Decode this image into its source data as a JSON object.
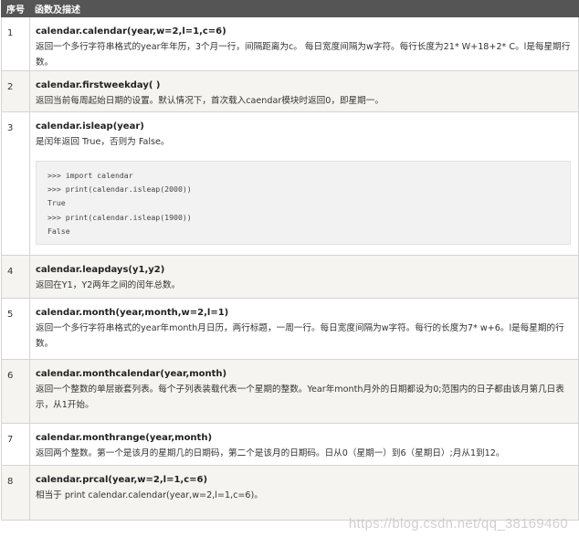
{
  "header": {
    "col_num": "序号",
    "col_desc": "函数及描述"
  },
  "rows": [
    {
      "num": "1",
      "name": "calendar.calendar(year,w=2,l=1,c=6)",
      "desc": "返回一个多行字符串格式的year年年历，3个月一行，间隔距离为c。 每日宽度间隔为w字符。每行长度为21* W+18+2* C。l是每星期行数。"
    },
    {
      "num": "2",
      "name": "calendar.firstweekday( )",
      "desc": "返回当前每周起始日期的设置。默认情况下，首次载入caendar模块时返回0，即星期一。"
    },
    {
      "num": "3",
      "name": "calendar.isleap(year)",
      "desc": "是闰年返回 True，否则为 False。",
      "code": [
        ">>> import calendar",
        ">>> print(calendar.isleap(2000))",
        "True",
        ">>> print(calendar.isleap(1900))",
        "False"
      ]
    },
    {
      "num": "4",
      "name": "calendar.leapdays(y1,y2)",
      "desc": "返回在Y1，Y2两年之间的闰年总数。"
    },
    {
      "num": "5",
      "name": "calendar.month(year,month,w=2,l=1)",
      "desc": "返回一个多行字符串格式的year年month月日历，两行标题，一周一行。每日宽度间隔为w字符。每行的长度为7* w+6。l是每星期的行数。"
    },
    {
      "num": "6",
      "name": "calendar.monthcalendar(year,month)",
      "desc": "返回一个整数的单层嵌套列表。每个子列表装载代表一个星期的整数。Year年month月外的日期都设为0;范围内的日子都由该月第几日表示，从1开始。"
    },
    {
      "num": "7",
      "name": "calendar.monthrange(year,month)",
      "desc": "返回两个整数。第一个是该月的星期几的日期码，第二个是该月的日期码。日从0（星期一）到6（星期日）;月从1到12。"
    },
    {
      "num": "8",
      "name": "calendar.prcal(year,w=2,l=1,c=6)",
      "desc": "相当于 print calendar.calendar(year,w=2,l=1,c=6)。"
    }
  ],
  "watermark": "https://blog.csdn.net/qq_38169460"
}
